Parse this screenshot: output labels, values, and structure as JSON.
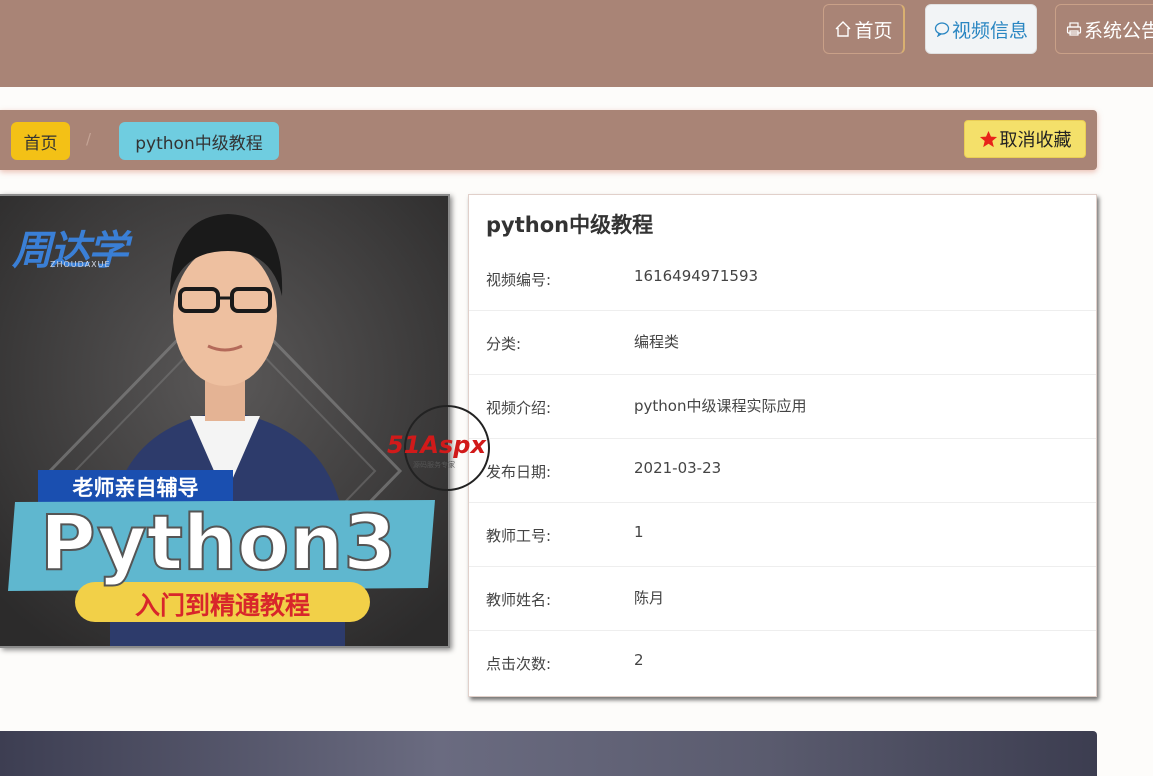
{
  "nav": {
    "home_label": "首页",
    "video_label": "视频信息",
    "notice_label": "系统公告"
  },
  "breadcrumb": {
    "home": "首页",
    "separator": "/",
    "current": "python中级教程"
  },
  "favorite_button": {
    "label": "取消收藏"
  },
  "cover": {
    "brand": "周达学",
    "brand_sub": "ZHOUDAXUE",
    "tagline": "老师亲自辅导",
    "big_text": "Python3",
    "sub_text": "入门到精通教程"
  },
  "detail": {
    "title": "python中级教程",
    "rows": [
      {
        "label": "视频编号:",
        "value": "1616494971593"
      },
      {
        "label": "分类:",
        "value": "编程类"
      },
      {
        "label": "视频介绍:",
        "value": "python中级课程实际应用"
      },
      {
        "label": "发布日期:",
        "value": "2021-03-23"
      },
      {
        "label": "教师工号:",
        "value": "1"
      },
      {
        "label": "教师姓名:",
        "value": "陈月"
      },
      {
        "label": "点击次数:",
        "value": "2"
      }
    ]
  },
  "watermark": {
    "text": "51Aspx",
    "sub": "源码服务专家"
  },
  "colors": {
    "header_bg": "#a98476",
    "crumb_home": "#f3c116",
    "crumb_current": "#6fcde0",
    "favorite_bg": "#f4e06a",
    "star": "#e8231a"
  }
}
